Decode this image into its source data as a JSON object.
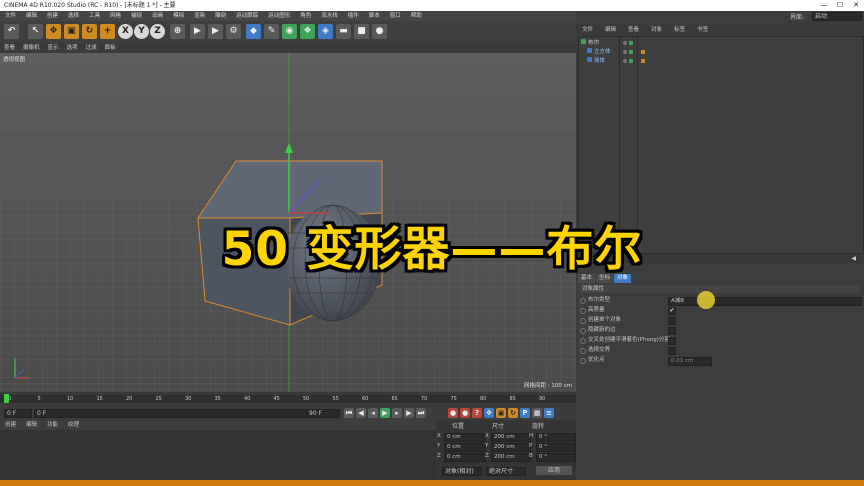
{
  "window": {
    "title": "CINEMA 4D R10.020 Studio (RC - R10) - [未标题 1 *] - 主要",
    "minimize": "—",
    "maximize": "☐",
    "close": "✕"
  },
  "menubar": [
    "文件",
    "编辑",
    "创建",
    "选择",
    "工具",
    "网格",
    "捕捉",
    "动画",
    "模拟",
    "渲染",
    "雕刻",
    "运动跟踪",
    "运动图形",
    "角色",
    "流水线",
    "插件",
    "脚本",
    "窗口",
    "帮助"
  ],
  "toolbar": {
    "buttons": [
      {
        "name": "undo-icon",
        "glyph": "↶"
      },
      {
        "name": "select-icon",
        "glyph": "↖"
      },
      {
        "name": "move-icon",
        "glyph": "✥"
      },
      {
        "name": "scale-icon",
        "glyph": "▣"
      },
      {
        "name": "rotate-icon",
        "glyph": "↻"
      },
      {
        "name": "add-icon",
        "glyph": "+"
      },
      {
        "name": "x-axis-icon",
        "glyph": "X"
      },
      {
        "name": "y-axis-icon",
        "glyph": "Y"
      },
      {
        "name": "z-axis-icon",
        "glyph": "Z"
      },
      {
        "name": "coord-system-icon",
        "glyph": "⊕"
      },
      {
        "name": "render-region-icon",
        "glyph": "▶"
      },
      {
        "name": "render-view-icon",
        "glyph": "▶"
      },
      {
        "name": "render-settings-icon",
        "glyph": "⚙"
      },
      {
        "name": "cube-icon",
        "glyph": "◆"
      },
      {
        "name": "pen-icon",
        "glyph": "✎"
      },
      {
        "name": "subdivision-icon",
        "glyph": "◉"
      },
      {
        "name": "array-icon",
        "glyph": "❖"
      },
      {
        "name": "deformer-icon",
        "glyph": "◈"
      },
      {
        "name": "floor-icon",
        "glyph": "▬"
      },
      {
        "name": "camera-icon",
        "glyph": "■"
      },
      {
        "name": "light-icon",
        "glyph": "●"
      }
    ]
  },
  "viewport": {
    "menu": [
      "查看",
      "摄像机",
      "显示",
      "选项",
      "过滤",
      "面板"
    ],
    "label": "透视视图",
    "grid_info": "网格间距 : 100 cm"
  },
  "timeline": {
    "ticks": [
      "0",
      "5",
      "10",
      "15",
      "20",
      "25",
      "30",
      "35",
      "40",
      "45",
      "50",
      "55",
      "60",
      "65",
      "70",
      "75",
      "80",
      "85",
      "90"
    ],
    "start_field": "0 F",
    "current_field": "0 F",
    "end_field": "90 F",
    "max_field": "90 F"
  },
  "bottom_panel": {
    "menu": [
      "创建",
      "编辑",
      "功能",
      "纹理"
    ]
  },
  "coordinates": {
    "headers": [
      "位置",
      "尺寸",
      "旋转"
    ],
    "rows": [
      {
        "axis": "X",
        "pos": "0 cm",
        "size": "200 cm",
        "rot_label": "H",
        "rot": "0 °"
      },
      {
        "axis": "Y",
        "pos": "0 cm",
        "size": "200 cm",
        "rot_label": "P",
        "rot": "0 °"
      },
      {
        "axis": "Z",
        "pos": "0 cm",
        "size": "200 cm",
        "rot_label": "B",
        "rot": "0 °"
      }
    ],
    "mode_select": "对象(相对)",
    "size_select": "绝对尺寸",
    "apply_button": "应用"
  },
  "right_panel": {
    "layout_label": "界面:",
    "layout_value": "启动",
    "om_tabs": [
      "文件",
      "编辑",
      "查看",
      "对象",
      "标签",
      "书签"
    ],
    "objects": [
      {
        "name": "布尔",
        "level": 0
      },
      {
        "name": "立方体",
        "level": 1
      },
      {
        "name": "球体",
        "level": 1
      }
    ],
    "attr_tabs": [
      "基本",
      "坐标",
      "对象"
    ],
    "attr_header": "对象属性",
    "attributes": [
      {
        "label": "布尔类型",
        "value": "A减B"
      },
      {
        "label": "高质量",
        "value": "✔"
      },
      {
        "label": "创建单个对象",
        "value": ""
      },
      {
        "label": "隐藏新的边",
        "value": ""
      },
      {
        "label": "交叉处创建平滑着色(Phong)分割",
        "value": ""
      },
      {
        "label": "选择交界",
        "value": ""
      },
      {
        "label": "优化点",
        "value": "0.01 cm"
      }
    ]
  },
  "overlay": {
    "title": "50 变形器——布尔"
  },
  "colors": {
    "accent_orange": "#d08a22",
    "title_yellow": "#ffd400",
    "selection_blue": "#3d7cc9"
  }
}
